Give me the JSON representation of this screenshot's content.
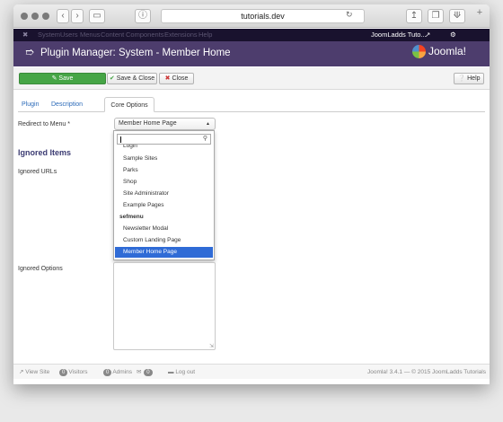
{
  "browser": {
    "url": "tutorials.dev"
  },
  "joomla": {
    "menu": [
      "System",
      "Users",
      "Menus",
      "Content",
      "Components",
      "Extensions",
      "Help"
    ],
    "user_menu": "JoomLadds Tuto...",
    "page_title": "Plugin Manager: System - Member Home",
    "logo_text": "Joomla!"
  },
  "toolbar": {
    "save": "Save",
    "save_close": "Save & Close",
    "close": "Close",
    "help": "Help"
  },
  "tabs": [
    "Plugin",
    "Description",
    "Core Options"
  ],
  "form": {
    "redirect_label": "Redirect to Menu *",
    "redirect_value": "Member Home Page",
    "search_value": "",
    "section_title": "Ignored Items",
    "ignored_urls_label": "Ignored URLs",
    "ignored_options_label": "Ignored Options"
  },
  "dropdown": {
    "options": [
      {
        "label": "Login",
        "type": "option"
      },
      {
        "label": "Sample Sites",
        "type": "option"
      },
      {
        "label": "Parks",
        "type": "option"
      },
      {
        "label": "Shop",
        "type": "option"
      },
      {
        "label": "Site Administrator",
        "type": "option"
      },
      {
        "label": "Example Pages",
        "type": "option"
      },
      {
        "label": "sefmenu",
        "type": "group"
      },
      {
        "label": "Newsletter Modal",
        "type": "option"
      },
      {
        "label": "Custom Landing Page",
        "type": "option"
      },
      {
        "label": "Member Home Page",
        "type": "selected"
      }
    ]
  },
  "status": {
    "view_site": "View Site",
    "visitors_count": "0",
    "visitors": "Visitors",
    "admins_count": "0",
    "admins": "Admins",
    "messages_count": "0",
    "logout": "Log out",
    "version": "Joomla! 3.4.1 — © 2015 JoomLadds Tutorials"
  },
  "colors": {
    "header": "#4d3d6d",
    "save_green": "#46a546",
    "selected": "#2f6bd6"
  }
}
